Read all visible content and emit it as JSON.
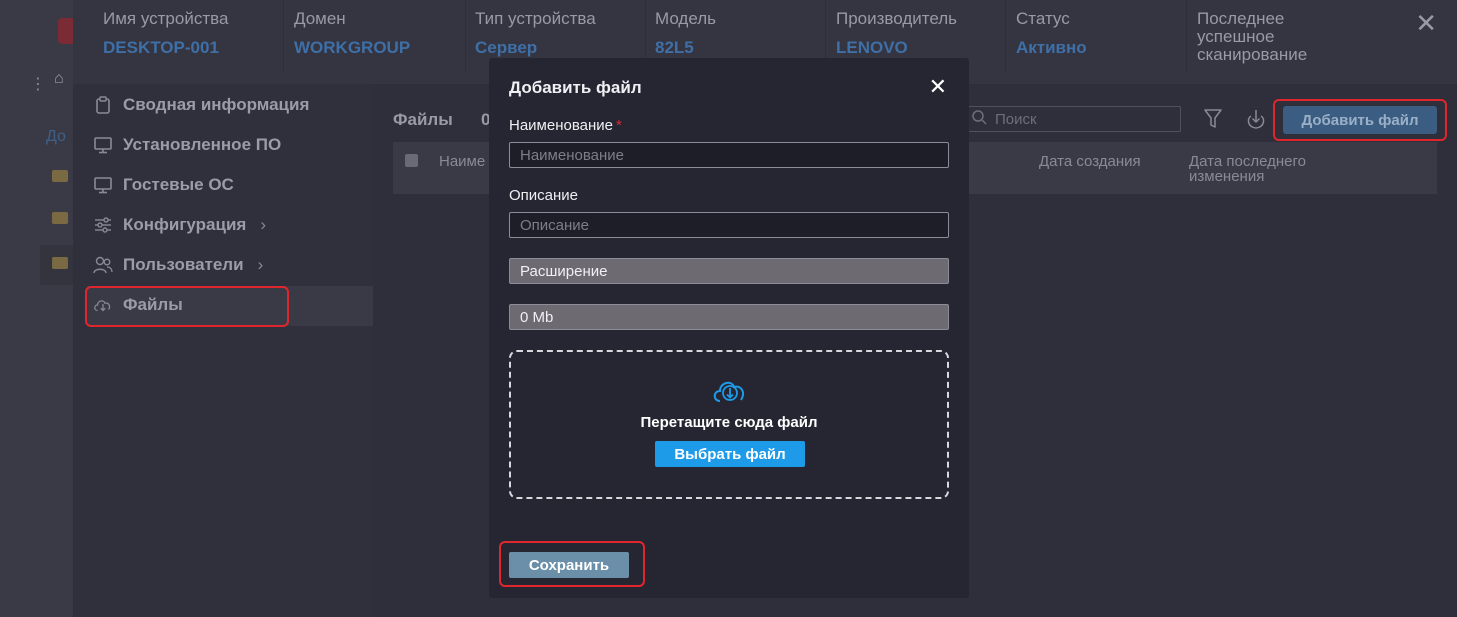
{
  "header": {
    "columns": [
      {
        "label": "Имя устройства",
        "value": "DESKTOP-001"
      },
      {
        "label": "Домен",
        "value": "WORKGROUP"
      },
      {
        "label": "Тип устройства",
        "value": "Сервер"
      },
      {
        "label": "Модель",
        "value": "82L5"
      },
      {
        "label": "Производитель",
        "value": "LENOVO"
      },
      {
        "label": "Статус",
        "value": "Активно"
      },
      {
        "label": "Последнее успешное сканирование",
        "value": ""
      }
    ]
  },
  "sidebar": {
    "items": [
      {
        "label": "Сводная информация",
        "icon": "clipboard-icon"
      },
      {
        "label": "Установленное ПО",
        "icon": "monitor-icon"
      },
      {
        "label": "Гостевые ОС",
        "icon": "monitor-icon"
      },
      {
        "label": "Конфигурация",
        "icon": "sliders-icon",
        "chevron": "›"
      },
      {
        "label": "Пользователи",
        "icon": "users-icon",
        "chevron": "›"
      },
      {
        "label": "Файлы",
        "icon": "cloud-download-icon",
        "active": true
      }
    ]
  },
  "content": {
    "title": "Файлы",
    "count": "0",
    "search_placeholder": "Поиск",
    "add_button": "Добавить файл",
    "columns": [
      "Наиме",
      "Дата создания",
      "Дата последнего изменения"
    ]
  },
  "background": {
    "link_text": "До"
  },
  "modal": {
    "title": "Добавить файл",
    "name_label": "Наименование",
    "required_mark": "*",
    "name_placeholder": "Наименование",
    "desc_label": "Описание",
    "desc_placeholder": "Описание",
    "extension_value": "Расширение",
    "size_value": "0 Mb",
    "drop_text": "Перетащите сюда файл",
    "choose_button": "Выбрать файл",
    "save_button": "Сохранить"
  },
  "colors": {
    "accent_blue": "#1e9be8",
    "highlight_red": "#e0262d",
    "header_value": "#3e6fa6"
  }
}
